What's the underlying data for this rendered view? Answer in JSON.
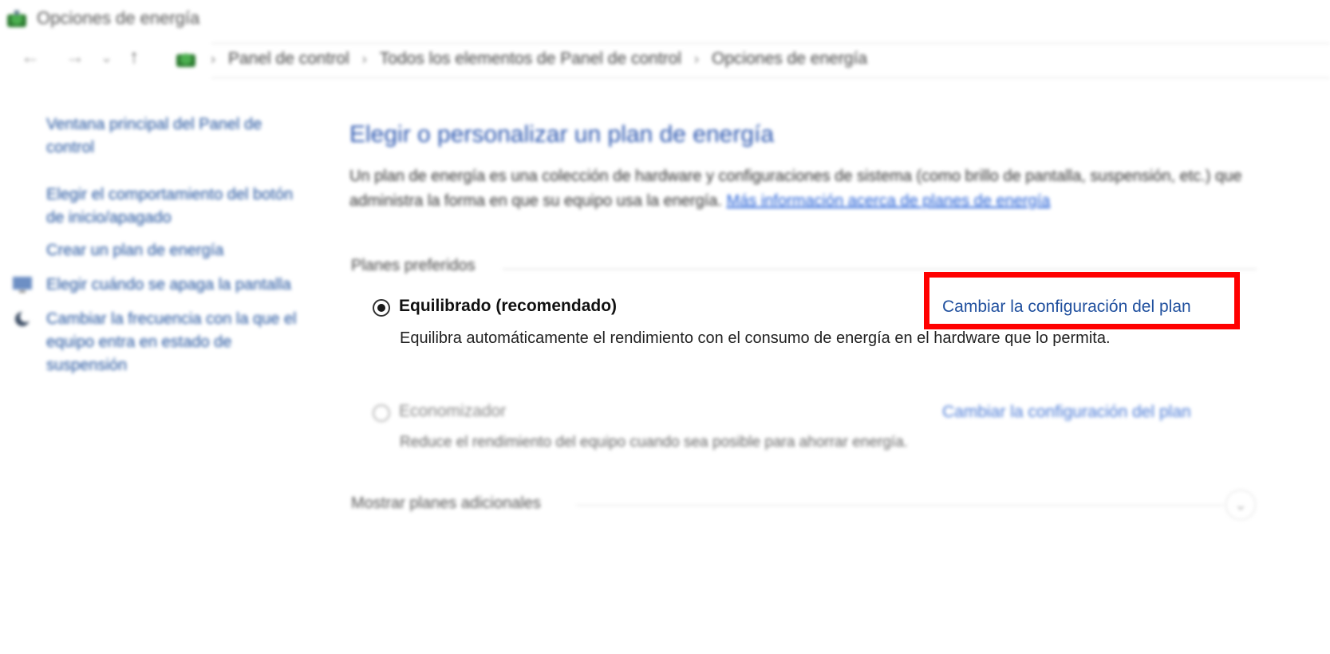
{
  "window": {
    "title": "Opciones de energía",
    "icon": "power-options-icon"
  },
  "nav": {
    "back": "←",
    "forward": "→",
    "recent": "⌄",
    "up": "↑"
  },
  "breadcrumb": {
    "items": [
      "Panel de control",
      "Todos los elementos de Panel de control",
      "Opciones de energía"
    ],
    "separator": "›"
  },
  "sidebar": {
    "items": [
      {
        "label": "Ventana principal del Panel de control",
        "icon": null
      },
      {
        "label": "Elegir el comportamiento del botón de inicio/apagado",
        "icon": null
      },
      {
        "label": "Crear un plan de energía",
        "icon": null
      },
      {
        "label": "Elegir cuándo se apaga la pantalla",
        "icon": "monitor-icon"
      },
      {
        "label": "Cambiar la frecuencia con la que el equipo entra en estado de suspensión",
        "icon": "moon-icon"
      }
    ]
  },
  "main": {
    "title": "Elegir o personalizar un plan de energía",
    "description": "Un plan de energía es una colección de hardware y configuraciones de sistema (como brillo de pantalla, suspensión, etc.) que administra la forma en que su equipo usa la energía.",
    "description_link": "Más información acerca de planes de energía",
    "preferred_label": "Planes preferidos",
    "plans": [
      {
        "name": "Equilibrado (recomendado)",
        "description": "Equilibra automáticamente el rendimiento con el consumo de energía en el hardware que lo permita.",
        "link": "Cambiar la configuración del plan",
        "selected": true
      },
      {
        "name": "Economizador",
        "description": "Reduce el rendimiento del equipo cuando sea posible para ahorrar energía.",
        "link": "Cambiar la configuración del plan",
        "selected": false
      }
    ],
    "more_plans_label": "Mostrar planes adicionales",
    "expand_icon": "chevron-down-icon"
  },
  "colors": {
    "highlight": "#ff0000",
    "link": "#1f4f9e",
    "title": "#2c57b0"
  }
}
